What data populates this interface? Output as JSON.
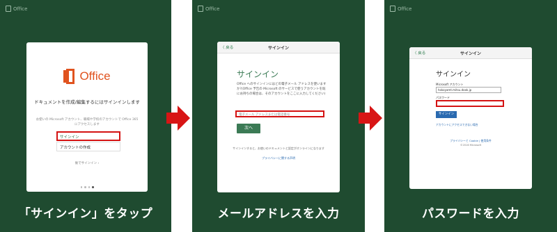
{
  "brand_label": "Office",
  "panel1": {
    "logo_text": "Office",
    "title": "ドキュメントを作成/編集するにはサインインします",
    "subtitle": "お使いの Microsoft アカウント、職場や学校のアカウントで Office 365 にアクセスします",
    "signin_button": "サインイン",
    "create_account": "アカウントの作成",
    "later": "後でサインイン ›",
    "caption": "「サインイン」をタップ"
  },
  "panel2": {
    "back": "〈 戻る",
    "nav_title": "サインイン",
    "heading": "サインイン",
    "description": "Office へのサインインにはどの電子メール アドレスを使いますか?(Office 予告の Microsoft のサービスで使うアカウントを既にお持ちの場合は、そのアカウントをここに入力してください)",
    "email_placeholder": "電子メール アドレスまたは電話番号",
    "next_button": "次へ",
    "footer": "サインインすると、お使いのドキュメントと設定がオンラインになります",
    "privacy_link": "プライバシーに関する声明",
    "caption": "メールアドレスを入力"
  },
  "panel3": {
    "back": "〈 戻る",
    "nav_title": "サインイン",
    "heading": "サインイン",
    "account_label": "Microsoft アカウント",
    "account_value": "hokoyamt.mitsu.dook.jp",
    "password_label": "パスワード",
    "signin_button": "サインイン",
    "cant_access": "アカウントにアクセスできない場合",
    "privacy": "プライバシーと Cookie | 使用条件",
    "copyright": "©2016 Microsoft",
    "caption": "パスワードを入力"
  },
  "colors": {
    "panel_bg": "#1f4b30",
    "office_orange": "#e0531f",
    "highlight_red": "#d41111",
    "arrow_red": "#d81515",
    "green_button": "#3b7a55",
    "blue_button": "#2a6ab0"
  }
}
